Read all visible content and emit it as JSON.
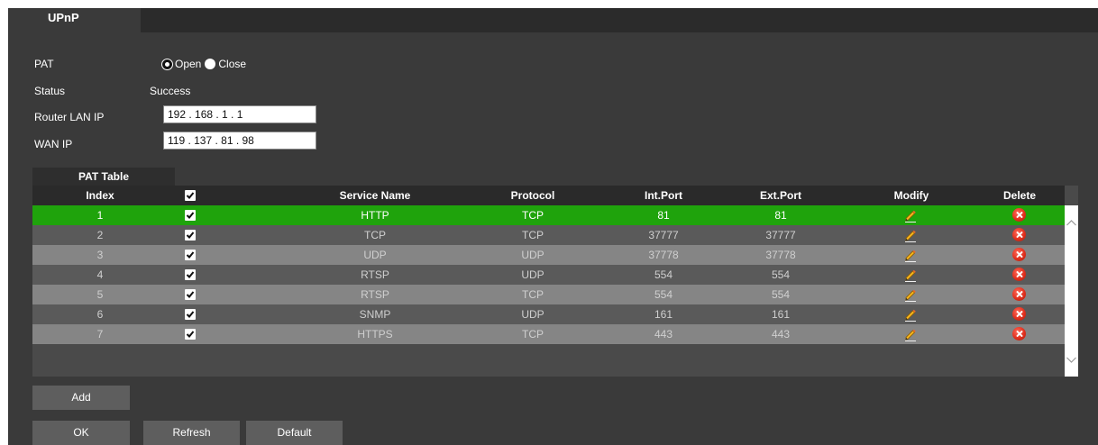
{
  "tabs": {
    "active": "UPnP"
  },
  "form": {
    "pat_label": "PAT",
    "pat_open": "Open",
    "pat_close": "Close",
    "status_label": "Status",
    "status_value": "Success",
    "router_ip_label": "Router LAN IP",
    "router_ip_value": "192 . 168 .   1  .   1",
    "wan_ip_label": "WAN IP",
    "wan_ip_value": "119 . 137 .  81  .  98"
  },
  "table": {
    "tab_label": "PAT Table",
    "headers": {
      "index": "Index",
      "service": "Service Name",
      "protocol": "Protocol",
      "int_port": "Int.Port",
      "ext_port": "Ext.Port",
      "modify": "Modify",
      "delete": "Delete"
    },
    "rows": [
      {
        "index": "1",
        "service": "HTTP",
        "protocol": "TCP",
        "int_port": "81",
        "ext_port": "81",
        "checked": true,
        "selected": true
      },
      {
        "index": "2",
        "service": "TCP",
        "protocol": "TCP",
        "int_port": "37777",
        "ext_port": "37777",
        "checked": true
      },
      {
        "index": "3",
        "service": "UDP",
        "protocol": "UDP",
        "int_port": "37778",
        "ext_port": "37778",
        "checked": true
      },
      {
        "index": "4",
        "service": "RTSP",
        "protocol": "UDP",
        "int_port": "554",
        "ext_port": "554",
        "checked": true
      },
      {
        "index": "5",
        "service": "RTSP",
        "protocol": "TCP",
        "int_port": "554",
        "ext_port": "554",
        "checked": true
      },
      {
        "index": "6",
        "service": "SNMP",
        "protocol": "UDP",
        "int_port": "161",
        "ext_port": "161",
        "checked": true
      },
      {
        "index": "7",
        "service": "HTTPS",
        "protocol": "TCP",
        "int_port": "443",
        "ext_port": "443",
        "checked": true
      }
    ]
  },
  "buttons": {
    "add": "Add",
    "ok": "OK",
    "refresh": "Refresh",
    "default": "Default"
  },
  "colors": {
    "panel_bg": "#3a3a3a",
    "selected_row": "#1fa30c",
    "delete_icon": "#e0301e",
    "button_bg": "#5e5e5e"
  },
  "icons": {
    "modify": "pencil-icon",
    "delete": "delete-x-icon",
    "checkbox": "checkbox-checked-icon"
  }
}
